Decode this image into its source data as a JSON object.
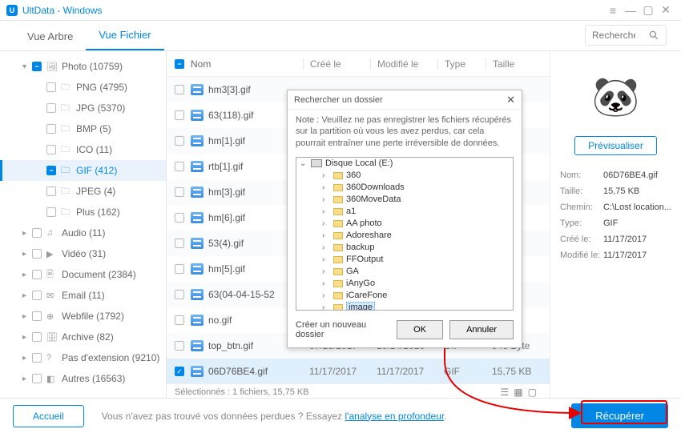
{
  "app": {
    "title": "UltData - Windows"
  },
  "tabs": {
    "tree": "Vue Arbre",
    "file": "Vue Fichier"
  },
  "search": {
    "placeholder": "Rechercher"
  },
  "tree": {
    "root": "Photo (10759)",
    "items": [
      "PNG (4795)",
      "JPG (5370)",
      "BMP (5)",
      "ICO (11)",
      "GIF (412)",
      "JPEG (4)",
      "Plus (162)"
    ],
    "cats": [
      "Audio (11)",
      "Vidéo (31)",
      "Document (2384)",
      "Email (11)",
      "Webfile (1792)",
      "Archive (82)",
      "Pas d'extension (9210)",
      "Autres (16563)"
    ]
  },
  "headers": {
    "name": "Nom",
    "created": "Créé le",
    "modified": "Modifié le",
    "type": "Type",
    "size": "Taille"
  },
  "files": [
    {
      "name": "hm3[3].gif",
      "created": "",
      "modified": "",
      "type": "",
      "size": ""
    },
    {
      "name": "63(118).gif",
      "created": "",
      "modified": "",
      "type": "",
      "size": ""
    },
    {
      "name": "hm[1].gif",
      "created": "",
      "modified": "",
      "type": "",
      "size": ""
    },
    {
      "name": "rtb[1].gif",
      "created": "",
      "modified": "",
      "type": "",
      "size": ""
    },
    {
      "name": "hm[3].gif",
      "created": "",
      "modified": "",
      "type": "",
      "size": ""
    },
    {
      "name": "hm[6].gif",
      "created": "",
      "modified": "",
      "type": "",
      "size": ""
    },
    {
      "name": "53(4).gif",
      "created": "",
      "modified": "",
      "type": "",
      "size": ""
    },
    {
      "name": "hm[5].gif",
      "created": "",
      "modified": "",
      "type": "",
      "size": ""
    },
    {
      "name": "63(04-04-15-52",
      "created": "",
      "modified": "",
      "type": "",
      "size": ""
    },
    {
      "name": "no.gif",
      "created": "",
      "modified": "",
      "type": "",
      "size": ""
    },
    {
      "name": "top_btn.gif",
      "created": "07/25/2017",
      "modified": "10/14/2016",
      "type": "GIF",
      "size": "946 Byte"
    },
    {
      "name": "06D76BE4.gif",
      "created": "11/17/2017",
      "modified": "11/17/2017",
      "type": "GIF",
      "size": "15,75 KB",
      "selected": true
    }
  ],
  "status": "Sélectionnés : 1 fichiers, 15,75 KB",
  "preview": {
    "btn": "Prévisualiser",
    "rows": {
      "name_l": "Nom:",
      "name_v": "06D76BE4.gif",
      "size_l": "Taille:",
      "size_v": "15,75 KB",
      "path_l": "Chemin:",
      "path_v": "C:\\Lost location...",
      "type_l": "Type:",
      "type_v": "GIF",
      "created_l": "Créé le:",
      "created_v": "11/17/2017",
      "modified_l": "Modifié le:",
      "modified_v": "11/17/2017"
    }
  },
  "bottom": {
    "home": "Accueil",
    "msg1": "Vous n'avez pas trouvé vos données perdues ? Essayez ",
    "deep": "l'analyse en profondeur",
    "dot": ".",
    "recover": "Récupérer"
  },
  "dialog": {
    "title": "Rechercher un dossier",
    "note": "Note : Veuillez ne pas enregistrer les fichiers récupérés sur la partition où vous les avez perdus, car cela pourrait entraîner une perte irréversible de données.",
    "root": "Disque Local (E:)",
    "folders": [
      "360",
      "360Downloads",
      "360MoveData",
      "a1",
      "AA photo",
      "Adoreshare",
      "backup",
      "FFOutput",
      "GA",
      "iAnyGo",
      "iCareFone",
      "image"
    ],
    "selected": "image",
    "newfolder": "Créer un nouveau dossier",
    "ok": "OK",
    "cancel": "Annuler"
  }
}
